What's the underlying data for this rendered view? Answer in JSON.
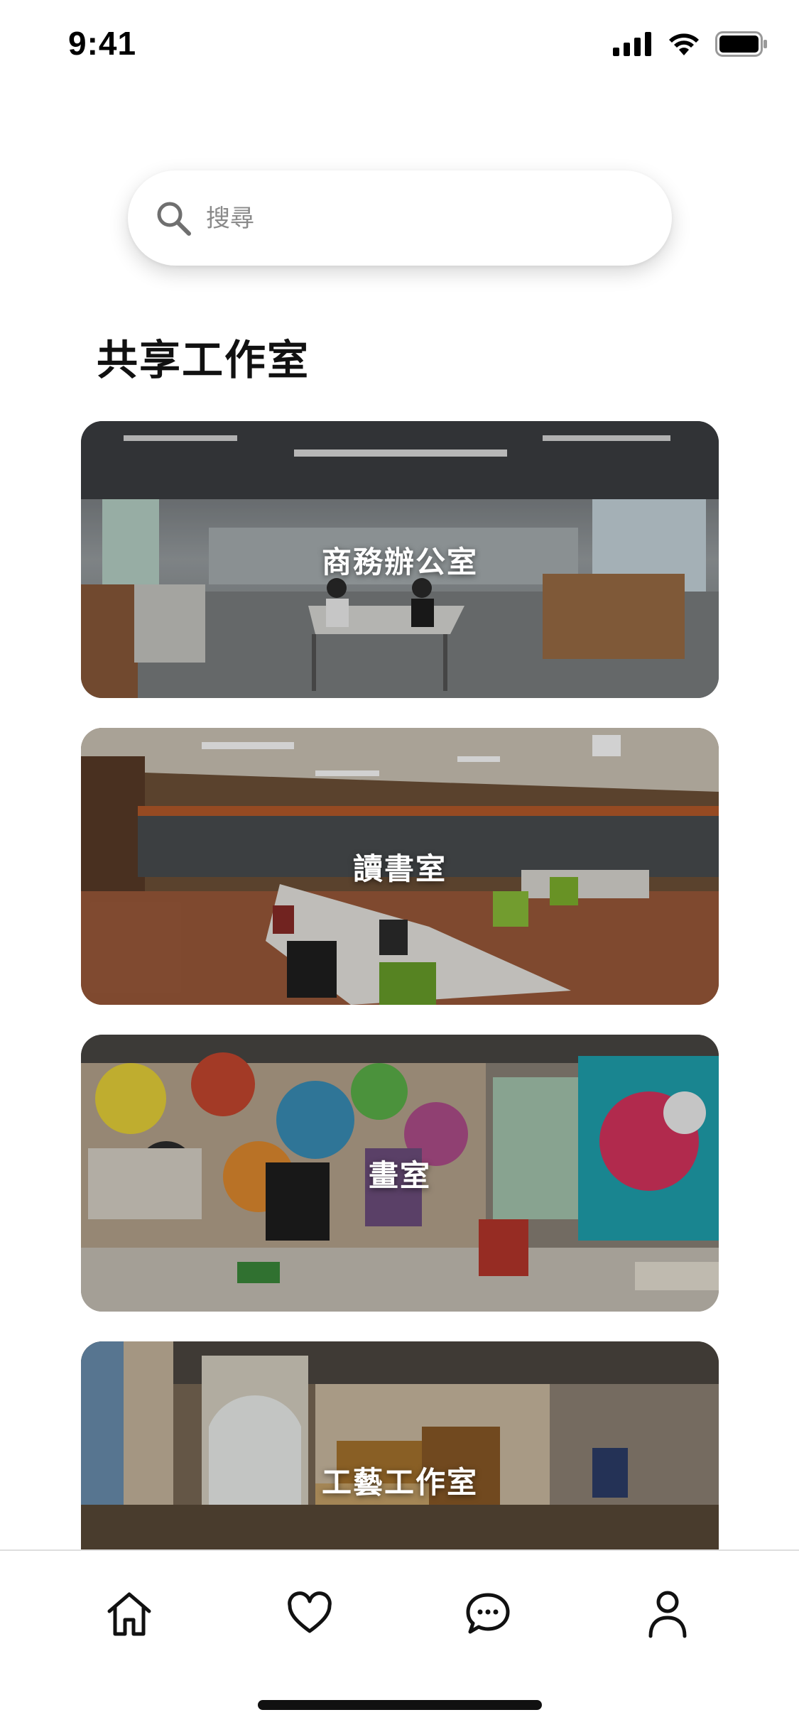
{
  "status_bar": {
    "time": "9:41",
    "icons": [
      "signal-icon",
      "wifi-icon",
      "battery-icon"
    ]
  },
  "search": {
    "placeholder": "搜尋",
    "value": "",
    "icon": "search-icon"
  },
  "section": {
    "title": "共享工作室"
  },
  "cards": [
    {
      "label": "商務辦公室",
      "image": "office-photo"
    },
    {
      "label": "讀書室",
      "image": "study-room-photo"
    },
    {
      "label": "畫室",
      "image": "art-studio-photo"
    },
    {
      "label": "工藝工作室",
      "image": "craft-workshop-photo"
    }
  ],
  "tab_bar": {
    "items": [
      {
        "icon": "home-icon",
        "active": true
      },
      {
        "icon": "heart-icon",
        "active": false
      },
      {
        "icon": "chat-icon",
        "active": false
      },
      {
        "icon": "profile-icon",
        "active": false
      }
    ]
  },
  "colors": {
    "background": "#ffffff",
    "text": "#111111",
    "placeholder": "#8a8a8a",
    "divider": "#dedede"
  }
}
